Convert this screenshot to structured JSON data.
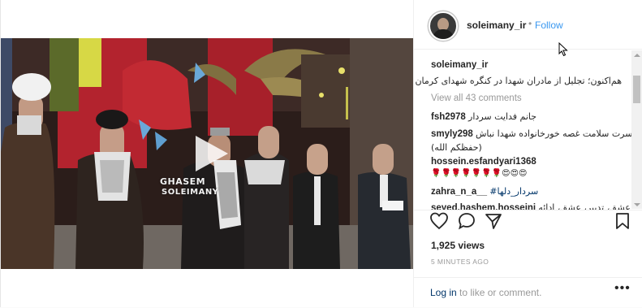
{
  "post": {
    "username": "soleimany_ir",
    "separator": "•",
    "follow_label": "Follow",
    "caption_user": "soleimany_ir",
    "caption_text": "هم‌اکنون؛ تجلیل از مادران شهدا در کنگره شهدای کرمان",
    "view_all_label": "View all 43 comments",
    "views": "1,925 views",
    "time_ago": "5 MINUTES AGO",
    "watermark_line1": "GHASEM",
    "watermark_line2": "SOLEIMANY"
  },
  "comments": [
    {
      "user": "fsh2978",
      "text": "جانم فدایت سردار"
    },
    {
      "user": "smyly298",
      "text": "سردارسرت سلامت غصه خورخانواده شهدا نباش",
      "text2": "(حفظکم الله)"
    },
    {
      "user": "hossein.esfandyari1368",
      "text": "🌹🌹🌹🌹🌹🌹🌹😍😍😍"
    },
    {
      "user": "zahra_n_a__",
      "text": "#سردار_دلها"
    },
    {
      "user": "seyed.hashem.hosseini",
      "text": "عشق، تدبیر، عشق، ادائه..."
    }
  ],
  "footer": {
    "login_label": "Log in",
    "login_suffix": " to like or comment.",
    "more_label": "•••"
  },
  "icons": {
    "like": "heart-icon",
    "comment": "comment-icon",
    "share": "share-icon",
    "save": "bookmark-icon",
    "play": "play-icon"
  },
  "colors": {
    "link": "#3897f0",
    "muted": "#999999",
    "text": "#262626"
  }
}
